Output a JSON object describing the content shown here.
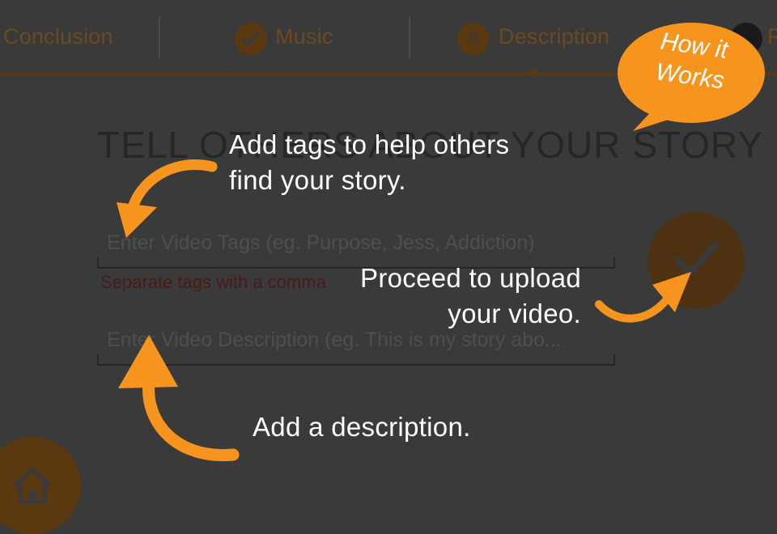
{
  "steps": [
    {
      "label": "Conclusion",
      "marker": ""
    },
    {
      "label": "Music",
      "marker": "check-icon"
    },
    {
      "label": "Description",
      "marker": "8"
    },
    {
      "label": "R",
      "marker": ""
    }
  ],
  "form": {
    "heading": "TELL OTHERS ABOUT YOUR STORY",
    "tags_placeholder": "Enter Video Tags (eg. Purpose, Jess, Addiction)",
    "tags_hint": "Separate tags with a comma",
    "description_placeholder": "Enter Video Description (eg. This is my story abo..."
  },
  "overlay": {
    "how_it_works": [
      "How it",
      "Works"
    ],
    "tip_tags": [
      "Add tags to help others",
      "find your story."
    ],
    "tip_proceed": [
      "Proceed to upload",
      "your video."
    ],
    "tip_description": "Add a description."
  },
  "icons": {
    "submit": "check-icon",
    "home": "home-icon",
    "arrows": "curved-arrow-icon"
  },
  "colors": {
    "background_dim": "#3a3a3a",
    "accent": "#f7941d",
    "accent_dim": "#5a3910",
    "overlay_text": "#ffffff"
  }
}
